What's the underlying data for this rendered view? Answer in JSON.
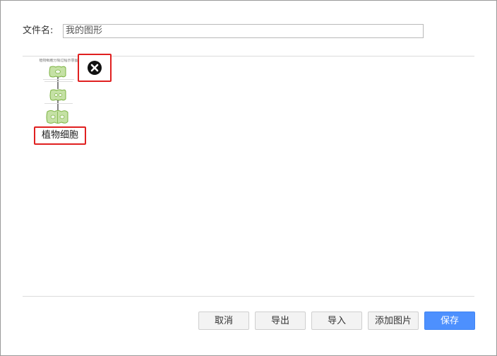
{
  "dialog": {
    "filename_label": "文件名:",
    "filename_value": "我的图形"
  },
  "gallery": {
    "items": [
      {
        "name": "植物细胞",
        "thumbnail_title": "植物细胞分裂过程示意图",
        "delete_icon": "close-circle-icon"
      }
    ]
  },
  "buttons": {
    "cancel": "取消",
    "export": "导出",
    "import": "导入",
    "add_image": "添加图片",
    "save": "保存"
  },
  "colors": {
    "primary": "#4d90fe",
    "highlight_box": "#e02020",
    "cell_fill": "#c5e1a5",
    "cell_stroke": "#7cb342"
  }
}
